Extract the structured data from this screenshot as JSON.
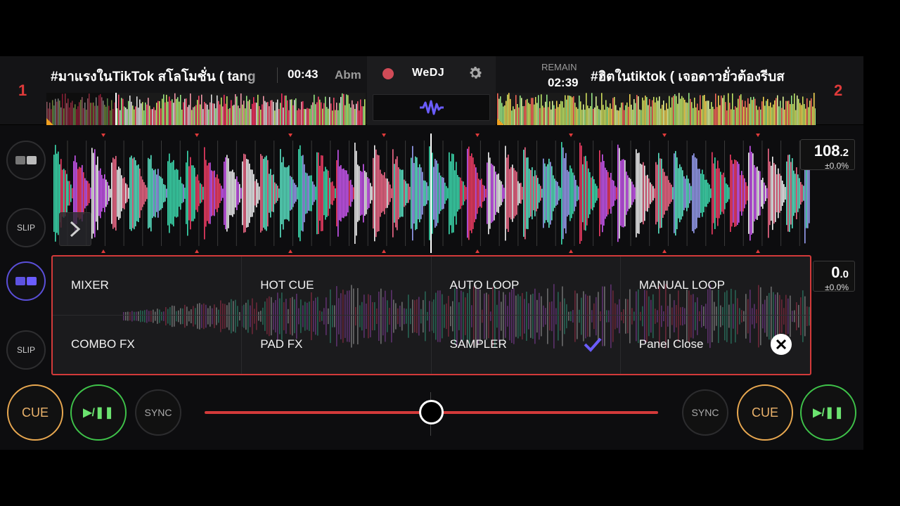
{
  "decks": {
    "left": {
      "number": "1",
      "title": "#มาแรงในTikTok สโลโมชั่น ( tang",
      "time": "00:43",
      "key": "Abm"
    },
    "right": {
      "number": "2",
      "title": "#ฮิตในtiktok ( เจอดาวยั่วต้องรีบส",
      "remain_label": "REMAIN",
      "remain_time": "02:39"
    }
  },
  "center": {
    "brand": "WeDJ",
    "icons": [
      "record-icon",
      "gear-icon",
      "waveform-icon"
    ]
  },
  "tempo": {
    "deck1_bpm": "108",
    "deck1_bpm_decimal": ".2",
    "deck1_pitch": "±0.0%",
    "deck2_bpm": "0",
    "deck2_bpm_decimal": ".0",
    "deck2_pitch": "±0.0%"
  },
  "side_buttons": {
    "slip_top": "SLIP",
    "slip_bottom": "SLIP"
  },
  "panel": {
    "items": [
      {
        "label": "MIXER"
      },
      {
        "label": "HOT CUE"
      },
      {
        "label": "AUTO LOOP"
      },
      {
        "label": "MANUAL LOOP"
      },
      {
        "label": "COMBO FX"
      },
      {
        "label": "PAD FX"
      },
      {
        "label": "SAMPLER",
        "checked": true
      },
      {
        "label": "Panel Close"
      }
    ]
  },
  "controls": {
    "cue_label": "CUE",
    "play_label": "▶/❚❚",
    "sync_label": "SYNC",
    "crossfader_position": 0.5
  },
  "colors": {
    "accent_red": "#d33a3a",
    "cue_orange": "#e9a850",
    "play_green": "#3fc34a",
    "check_purple": "#6a5cff"
  }
}
